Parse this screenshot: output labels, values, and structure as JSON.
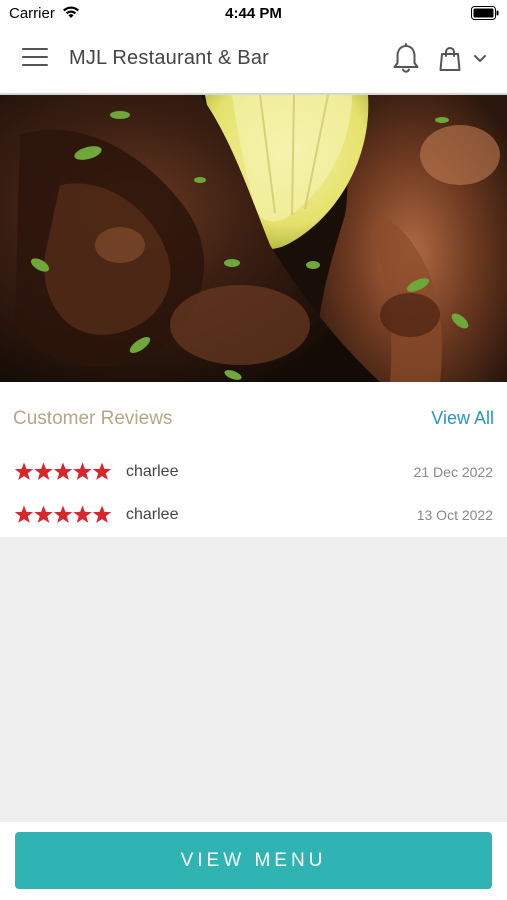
{
  "status_bar": {
    "carrier": "Carrier",
    "time": "4:44 PM"
  },
  "header": {
    "title": "MJL Restaurant & Bar",
    "icons": [
      "menu-icon",
      "bell-icon",
      "shopping-bag-icon",
      "chevron-down-icon"
    ]
  },
  "hero": {
    "description_icon": "food-photo"
  },
  "reviews": {
    "title": "Customer Reviews",
    "view_all_label": "View All",
    "star_color": "#d8262c",
    "items": [
      {
        "rating": 5,
        "name": "charlee",
        "date": "21 Dec 2022"
      },
      {
        "rating": 5,
        "name": "charlee",
        "date": "13 Oct 2022"
      }
    ]
  },
  "footer": {
    "button_label": "VIEW MENU",
    "accent_color": "#30b3b3"
  }
}
